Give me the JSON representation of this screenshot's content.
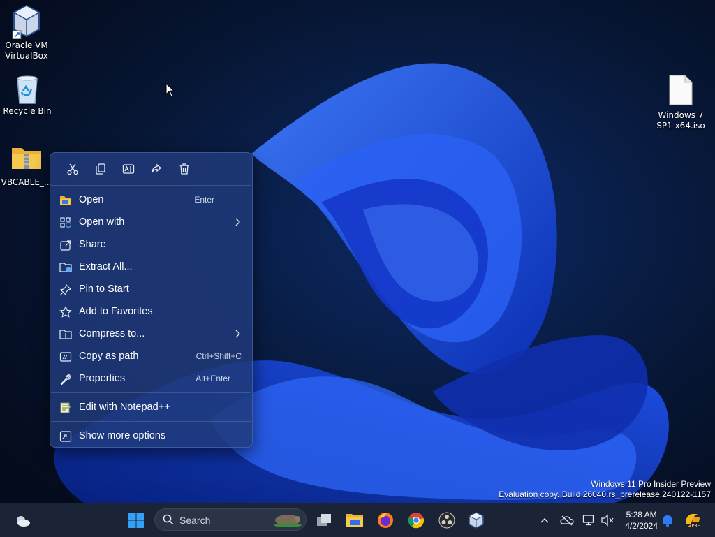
{
  "desktop": {
    "icons": [
      {
        "label": "Oracle VM VirtualBox"
      },
      {
        "label": "Recycle Bin"
      },
      {
        "label": "VBCABLE_..."
      },
      {
        "label": "Windows 7 SP1 x64.iso"
      }
    ],
    "watermark_line1": "Windows 11 Pro Insider Preview",
    "watermark_line2": "Evaluation copy. Build 26040.rs_prerelease.240122-1157"
  },
  "context_menu": {
    "toolbar": [
      "cut-icon",
      "copy-icon",
      "rename-icon",
      "share-icon",
      "delete-icon"
    ],
    "items": [
      {
        "label": "Open",
        "shortcut": "Enter",
        "icon": "folder-icon"
      },
      {
        "label": "Open with",
        "shortcut": "",
        "icon": "open-with-icon",
        "submenu": true
      },
      {
        "label": "Share",
        "shortcut": "",
        "icon": "share-icon"
      },
      {
        "label": "Extract All...",
        "shortcut": "",
        "icon": "extract-icon"
      },
      {
        "label": "Pin to Start",
        "shortcut": "",
        "icon": "pin-icon"
      },
      {
        "label": "Add to Favorites",
        "shortcut": "",
        "icon": "star-icon"
      },
      {
        "label": "Compress to...",
        "shortcut": "",
        "icon": "compress-icon",
        "submenu": true
      },
      {
        "label": "Copy as path",
        "shortcut": "Ctrl+Shift+C",
        "icon": "copy-path-icon"
      },
      {
        "label": "Properties",
        "shortcut": "Alt+Enter",
        "icon": "wrench-icon"
      },
      {
        "label": "Edit with Notepad++",
        "shortcut": "",
        "icon": "notepad-plus-icon"
      },
      {
        "label": "Show more options",
        "shortcut": "",
        "icon": "more-options-icon"
      }
    ]
  },
  "taskbar": {
    "search_placeholder": "Search",
    "clock_time": "5:28 AM",
    "clock_date": "4/2/2024",
    "accent": "#2f6df2"
  }
}
